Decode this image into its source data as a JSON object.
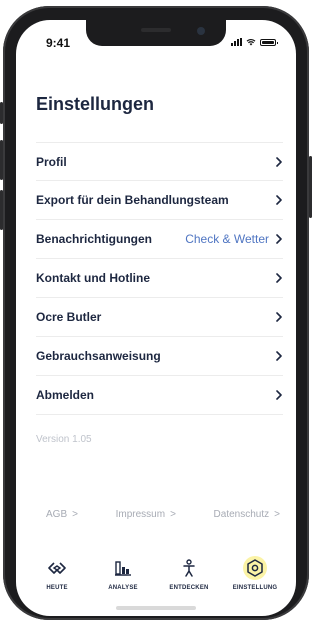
{
  "status_bar": {
    "time": "9:41"
  },
  "page": {
    "title": "Einstellungen"
  },
  "menu": {
    "items": [
      {
        "label": "Profil",
        "value": ""
      },
      {
        "label": "Export für dein Behandlungsteam",
        "value": ""
      },
      {
        "label": "Benachrichtigungen",
        "value": "Check & Wetter"
      },
      {
        "label": "Kontakt und Hotline",
        "value": ""
      },
      {
        "label": "Ocre Butler",
        "value": ""
      },
      {
        "label": "Gebrauchsanweisung",
        "value": ""
      },
      {
        "label": "Abmelden",
        "value": ""
      }
    ]
  },
  "version": "Version 1.05",
  "footer_links": [
    {
      "label": "AGB",
      "arrow": ">"
    },
    {
      "label": "Impressum",
      "arrow": ">"
    },
    {
      "label": "Datenschutz",
      "arrow": ">"
    }
  ],
  "tabbar": {
    "tabs": [
      {
        "label": "HEUTE",
        "icon": "link-icon",
        "active": false
      },
      {
        "label": "ANALYSE",
        "icon": "bar-chart-icon",
        "active": false
      },
      {
        "label": "ENTDECKEN",
        "icon": "figure-icon",
        "active": false
      },
      {
        "label": "EINSTELLUNG",
        "icon": "hexagon-icon",
        "active": true
      }
    ]
  },
  "colors": {
    "navy": "#1d2740",
    "accent_blue": "#4f75c2",
    "active_tab_bg": "#fbf3a6"
  }
}
